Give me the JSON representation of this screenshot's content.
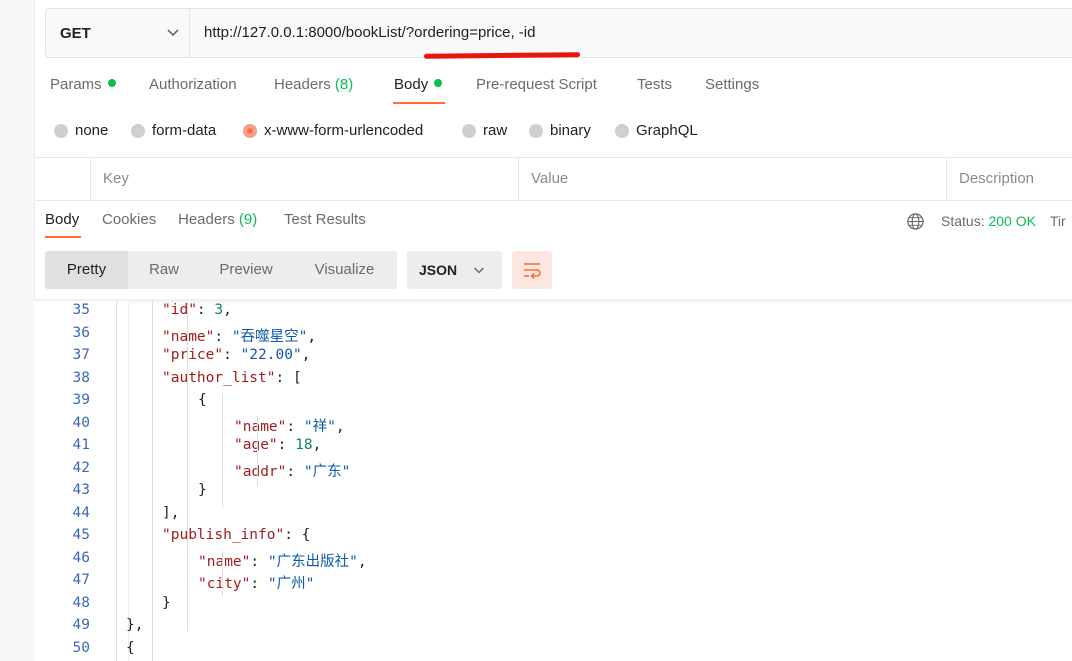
{
  "request": {
    "method": "GET",
    "url": "http://127.0.0.1:8000/bookList/?ordering=price, -id",
    "tabs": [
      {
        "label": "Params",
        "dot": true
      },
      {
        "label": "Authorization"
      },
      {
        "label": "Headers",
        "count": "(8)"
      },
      {
        "label": "Body",
        "dot": true
      },
      {
        "label": "Pre-request Script"
      },
      {
        "label": "Tests"
      },
      {
        "label": "Settings"
      }
    ],
    "active_tab": "Body",
    "body_types": [
      "none",
      "form-data",
      "x-www-form-urlencoded",
      "raw",
      "binary",
      "GraphQL"
    ],
    "selected_body_type": "x-www-form-urlencoded",
    "kv_headers": [
      "Key",
      "Value",
      "Description"
    ]
  },
  "response": {
    "tabs": [
      {
        "label": "Body"
      },
      {
        "label": "Cookies"
      },
      {
        "label": "Headers",
        "count": "(9)"
      },
      {
        "label": "Test Results"
      }
    ],
    "status_label": "Status:",
    "status_value": "200 OK",
    "time_label": "Tir",
    "view_modes": [
      "Pretty",
      "Raw",
      "Preview",
      "Visualize"
    ],
    "active_view": "Pretty",
    "format": "JSON"
  },
  "code_lines": [
    {
      "n": "35",
      "t": "\"id\": 3,"
    },
    {
      "n": "36",
      "t": "\"name\": \"吞噬星空\","
    },
    {
      "n": "37",
      "t": "\"price\": \"22.00\","
    },
    {
      "n": "38",
      "t": "\"author_list\": ["
    },
    {
      "n": "39",
      "t": "{"
    },
    {
      "n": "40",
      "t": "\"name\": \"祥\","
    },
    {
      "n": "41",
      "t": "\"age\": 18,"
    },
    {
      "n": "42",
      "t": "\"addr\": \"广东\""
    },
    {
      "n": "43",
      "t": "}"
    },
    {
      "n": "44",
      "t": "],"
    },
    {
      "n": "45",
      "t": "\"publish_info\": {"
    },
    {
      "n": "46",
      "t": "\"name\": \"广东出版社\","
    },
    {
      "n": "47",
      "t": "\"city\": \"广州\""
    },
    {
      "n": "48",
      "t": "}"
    },
    {
      "n": "49",
      "t": "},"
    },
    {
      "n": "50",
      "t": "{"
    }
  ],
  "colors": {
    "accent": "#ff6c37",
    "success": "#0cbb52",
    "underline_mark": "#e8160c"
  }
}
